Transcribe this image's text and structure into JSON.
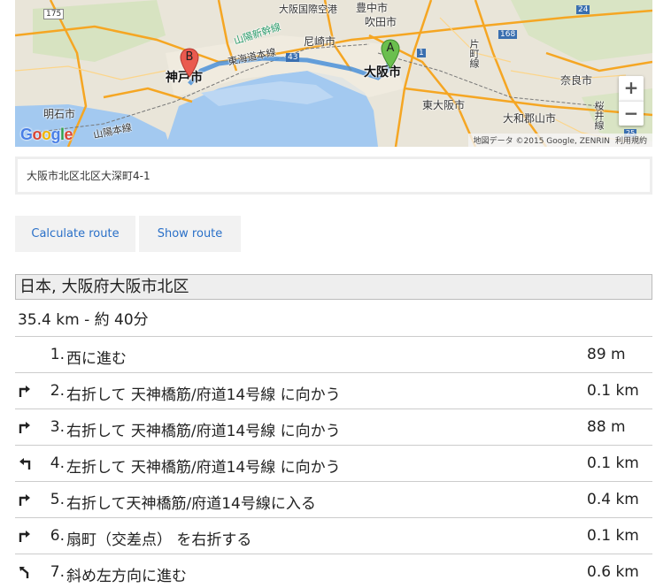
{
  "map": {
    "labels": {
      "toyonaka": "豊中市",
      "suita": "吹田市",
      "itami_airport": "大阪国際空港",
      "sanyo_shinkansen": "山陽新幹線",
      "amagasaki": "尼崎市",
      "kobe": "神戸市",
      "tokaido": "東海道本線",
      "osaka": "大阪市",
      "katamachi": "片町線",
      "nara": "奈良市",
      "higashiosaka": "東大阪市",
      "yamatokoriyama": "大和郡山市",
      "sakurai": "桜井線",
      "akashi": "明石市",
      "sanyo_line": "山陽本線",
      "shield_175": "175",
      "shield_24": "24",
      "shield_168": "168",
      "shield_43": "43",
      "shield_1": "1",
      "shield_25": "25"
    },
    "marker_a": "A",
    "marker_b": "B",
    "zoom_in": "+",
    "zoom_out": "−",
    "google_letters": [
      "G",
      "o",
      "o",
      "g",
      "l",
      "e"
    ],
    "attribution": "地図データ ©2015 Google, ZENRIN",
    "terms": "利用規約",
    "colors": {
      "route": "#4a90d9",
      "water": "#a3c9f0",
      "highway": "#f5a623",
      "land": "#e8e4d8"
    }
  },
  "address_input": {
    "value": "大阪市北区北区大深町4-1"
  },
  "buttons": {
    "calculate": "Calculate route",
    "show": "Show route"
  },
  "directions": {
    "destination": "日本, 大阪府大阪市北区",
    "summary": "35.4 km - 約 40分",
    "steps": [
      {
        "icon": "none",
        "num": "1.",
        "text": "西に進む",
        "dist": "89 m"
      },
      {
        "icon": "turn-right",
        "num": "2.",
        "text": "右折して 天神橋筋/府道14号線 に向かう",
        "dist": "0.1 km"
      },
      {
        "icon": "turn-right",
        "num": "3.",
        "text": "右折して 天神橋筋/府道14号線 に向かう",
        "dist": "88 m"
      },
      {
        "icon": "turn-left",
        "num": "4.",
        "text": "左折して 天神橋筋/府道14号線 に向かう",
        "dist": "0.1 km"
      },
      {
        "icon": "turn-right",
        "num": "5.",
        "text": "右折して天神橋筋/府道14号線に入る",
        "dist": "0.4 km"
      },
      {
        "icon": "turn-right",
        "num": "6.",
        "text": "扇町（交差点） を右折する",
        "dist": "0.1 km"
      },
      {
        "icon": "slight-left",
        "num": "7.",
        "text": "斜め左方向に進む",
        "dist": "0.6 km"
      }
    ]
  }
}
